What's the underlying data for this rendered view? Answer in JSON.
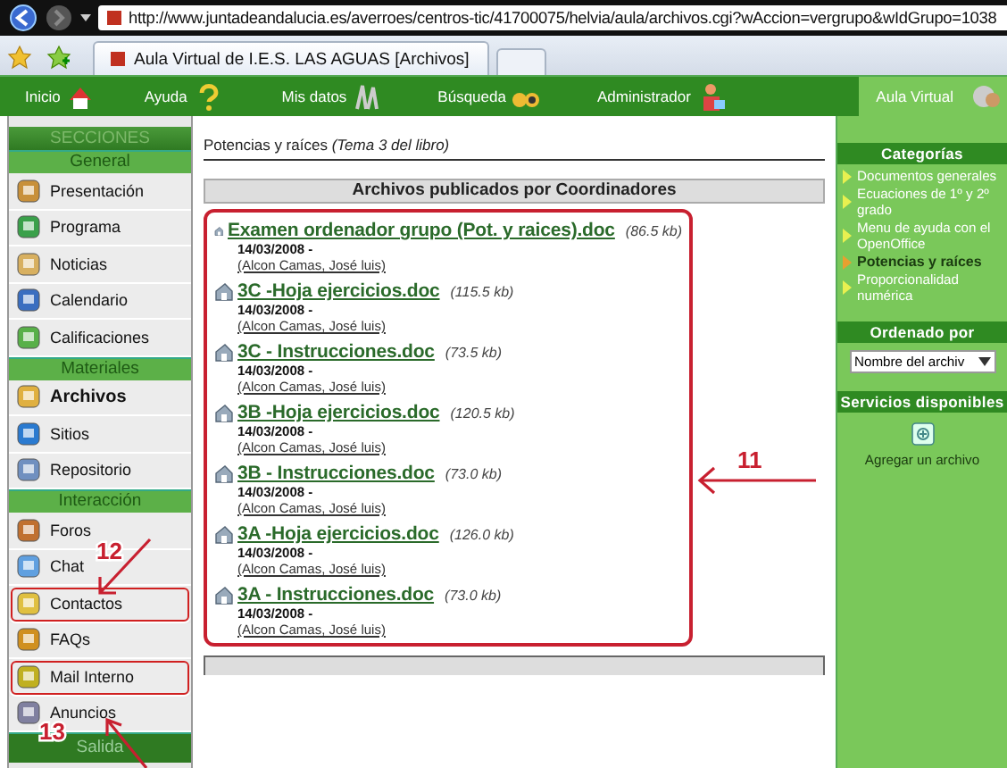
{
  "browser": {
    "url": "http://www.juntadeandalucia.es/averroes/centros-tic/41700075/helvia/aula/archivos.cgi?wAccion=vergrupo&wIdGrupo=1038",
    "tab_title": "Aula Virtual de I.E.S. LAS AGUAS [Archivos]"
  },
  "nav": [
    {
      "label": "Inicio",
      "selected": false
    },
    {
      "label": "Ayuda",
      "selected": false
    },
    {
      "label": "Mis datos",
      "selected": false
    },
    {
      "label": "Búsqueda",
      "selected": false
    },
    {
      "label": "Administrador",
      "selected": false
    },
    {
      "label": "Aula Virtual",
      "selected": true
    }
  ],
  "sidebar": {
    "title": "SECCIONES",
    "groups": [
      {
        "title": "General",
        "items": [
          {
            "label": "Presentación",
            "selected": false,
            "circled": false
          },
          {
            "label": "Programa",
            "selected": false,
            "circled": false
          },
          {
            "label": "Noticias",
            "selected": false,
            "circled": false
          },
          {
            "label": "Calendario",
            "selected": false,
            "circled": false
          },
          {
            "label": "Calificaciones",
            "selected": false,
            "circled": false
          }
        ]
      },
      {
        "title": "Materiales",
        "items": [
          {
            "label": "Archivos",
            "selected": true,
            "circled": false
          },
          {
            "label": "Sitios",
            "selected": false,
            "circled": false
          },
          {
            "label": "Repositorio",
            "selected": false,
            "circled": false
          }
        ]
      },
      {
        "title": "Interacción",
        "items": [
          {
            "label": "Foros",
            "selected": false,
            "circled": false
          },
          {
            "label": "Chat",
            "selected": false,
            "circled": false
          },
          {
            "label": "Contactos",
            "selected": false,
            "circled": true
          },
          {
            "label": "FAQs",
            "selected": false,
            "circled": false
          },
          {
            "label": "Mail Interno",
            "selected": false,
            "circled": true
          },
          {
            "label": "Anuncios",
            "selected": false,
            "circled": false
          }
        ]
      },
      {
        "title": "Salida"
      }
    ]
  },
  "breadcrumb": "Potencias y raíces *(Tema 3 del libro)*",
  "files": {
    "heading": "Archivos publicados por Coordinadores",
    "circled": true,
    "items": [
      {
        "name": "Examen ordenador grupo (Pot. y raices).doc",
        "size": "(86.5 kb)",
        "date": "14/03/2008 -",
        "author": "(Alcon Camas, José luis)"
      },
      {
        "name": "3C -Hoja ejercicios.doc",
        "size": "(115.5 kb)",
        "date": "14/03/2008 -",
        "author": "(Alcon Camas, José luis)"
      },
      {
        "name": "3C - Instrucciones.doc",
        "size": "(73.5 kb)",
        "date": "14/03/2008 -",
        "author": "(Alcon Camas, José luis)"
      },
      {
        "name": "3B -Hoja ejercicios.doc",
        "size": "(120.5 kb)",
        "date": "14/03/2008 -",
        "author": "(Alcon Camas, José luis)"
      },
      {
        "name": "3B - Instrucciones.doc",
        "size": "(73.0 kb)",
        "date": "14/03/2008 -",
        "author": "(Alcon Camas, José luis)"
      },
      {
        "name": "3A -Hoja ejercicios.doc",
        "size": "(126.0 kb)",
        "date": "14/03/2008 -",
        "author": "(Alcon Camas, José luis)"
      },
      {
        "name": "3A - Instrucciones.doc",
        "size": "(73.0 kb)",
        "date": "14/03/2008 -",
        "author": "(Alcon Camas, José luis)"
      }
    ]
  },
  "right": {
    "categories_title": "Categorías",
    "categories": [
      {
        "label": "Documentos generales",
        "selected": false
      },
      {
        "label": "Ecuaciones de 1º y 2º grado",
        "selected": false
      },
      {
        "label": "Menu de ayuda con el OpenOffice",
        "selected": false
      },
      {
        "label": "Potencias y raíces",
        "selected": true
      },
      {
        "label": "Proporcionalidad numérica",
        "selected": false
      }
    ],
    "sort_title": "Ordenado por",
    "sort_value": "Nombre del archiv",
    "services_title": "Servicios disponibles",
    "service": "Agregar un archivo"
  },
  "annotations": [
    {
      "label": "11"
    },
    {
      "label": "12"
    },
    {
      "label": "13"
    }
  ]
}
